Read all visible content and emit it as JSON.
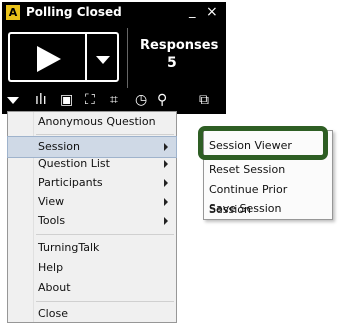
{
  "window": {
    "logo": "A",
    "title": "Polling Closed",
    "minimize": "_",
    "close": "×"
  },
  "responses": {
    "label": "Responses",
    "count": "5"
  },
  "toolbar": {
    "icons": [
      "caret-down-icon",
      "bar-chart-icon",
      "display-icon",
      "expand-icon",
      "grid-icon",
      "clock-icon",
      "presenter-icon",
      "popout-icon"
    ],
    "glyphs": {
      "bars": "ılı",
      "display": "▣",
      "expand": "⛶",
      "grid": "⌗",
      "clock": "◷",
      "presenter": "⚲",
      "popout": "⧉"
    }
  },
  "menu": {
    "items": [
      {
        "label": "Anonymous Question"
      },
      {
        "label": "Session"
      },
      {
        "label": "Question List"
      },
      {
        "label": "Participants"
      },
      {
        "label": "View"
      },
      {
        "label": "Tools"
      },
      {
        "label": "TurningTalk"
      },
      {
        "label": "Help"
      },
      {
        "label": "About"
      },
      {
        "label": "Close"
      }
    ]
  },
  "submenu": {
    "items": [
      {
        "label": "Session Viewer"
      },
      {
        "label": "Reset Session"
      },
      {
        "label": "Continue Prior Session"
      },
      {
        "label": "Save Session"
      }
    ]
  },
  "colors": {
    "window_bg": "#000000",
    "menu_bg": "#f0f0f0",
    "highlight": "#cfd9e6",
    "callout_border": "#2e5e24",
    "logo": "#e9c21a"
  }
}
